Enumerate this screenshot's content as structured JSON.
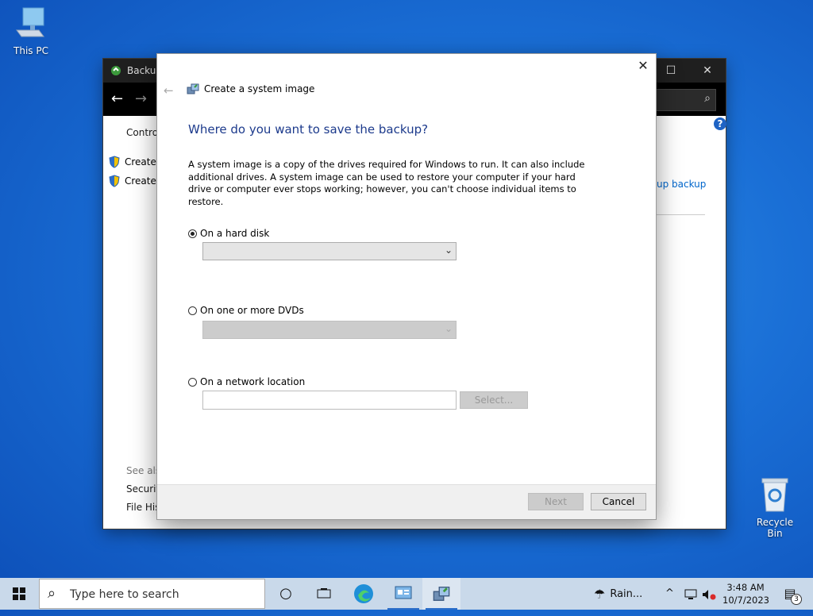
{
  "desktop": {
    "this_pc": "This PC",
    "recycle_bin": "Recycle Bin"
  },
  "control_panel": {
    "title": "Backup",
    "nav_home": "Control",
    "links": [
      "Create a",
      "Create a"
    ],
    "right_link": "up backup",
    "see_also": "See also",
    "see_also_items": [
      "Security",
      "File Hist"
    ]
  },
  "dialog": {
    "title": "Create a system image",
    "heading": "Where do you want to save the backup?",
    "description": "A system image is a copy of the drives required for Windows to run. It can also include additional drives. A system image can be used to restore your computer if your hard drive or computer ever stops working; however, you can't choose individual items to restore.",
    "options": [
      {
        "label": "On a hard disk",
        "selected": true
      },
      {
        "label": "On one or more DVDs",
        "selected": false
      },
      {
        "label": "On a network location",
        "selected": false
      }
    ],
    "select_button": "Select...",
    "next_button": "Next",
    "cancel_button": "Cancel"
  },
  "taskbar": {
    "search_placeholder": "Type here to search",
    "weather": "Rain...",
    "time": "3:48 AM",
    "date": "10/7/2023",
    "notification_count": "3"
  },
  "colors": {
    "heading": "#1c3a8c",
    "accent": "#2d6ec8"
  }
}
